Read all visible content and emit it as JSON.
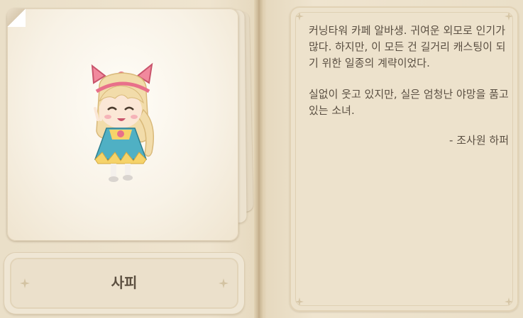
{
  "character": {
    "name": "사피",
    "description": [
      "커닝타워 카페 알바생. 귀여운 외모로 인기가 많다. 하지만, 이 모든 건 길거리 캐스팅이 되기 위한 일종의 계략이었다.",
      "실없이 웃고 있지만, 실은 엄청난 야망을 품고 있는 소녀."
    ],
    "signature": "- 조사원 하퍼"
  },
  "colors": {
    "text": "#5a4f42",
    "bow": "#e8708a",
    "hair": "#f2dcaa",
    "dress": "#4fb0c4"
  }
}
